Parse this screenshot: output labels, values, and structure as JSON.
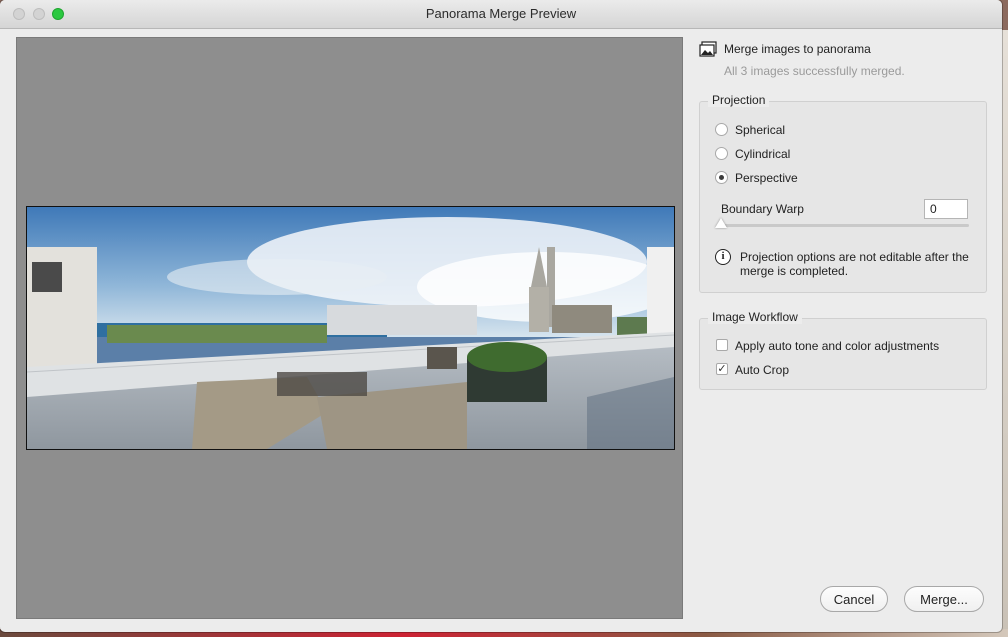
{
  "window": {
    "title": "Panorama Merge Preview"
  },
  "panel": {
    "heading": "Merge images to panorama",
    "status": "All 3 images successfully merged.",
    "projection": {
      "legend": "Projection",
      "options": [
        {
          "label": "Spherical",
          "selected": false
        },
        {
          "label": "Cylindrical",
          "selected": false
        },
        {
          "label": "Perspective",
          "selected": true
        }
      ],
      "boundary_warp_label": "Boundary Warp",
      "boundary_warp_value": "0",
      "boundary_warp_level": 0,
      "note": "Projection options are not editable after the merge is completed."
    },
    "workflow": {
      "legend": "Image Workflow",
      "options": [
        {
          "label": "Apply auto tone and color adjustments",
          "checked": false
        },
        {
          "label": "Auto Crop",
          "checked": true
        }
      ]
    }
  },
  "buttons": {
    "cancel": "Cancel",
    "merge": "Merge..."
  },
  "colors": {
    "maximize": "#2bc840",
    "preview_bg": "#8e8e8e",
    "window_bg": "#ececec"
  }
}
